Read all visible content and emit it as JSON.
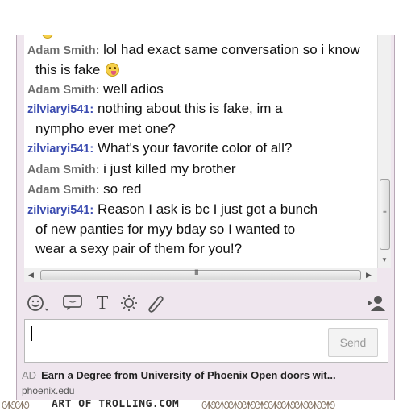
{
  "chat": {
    "messages": [
      {
        "sender": "Adam Smith:",
        "text": "lol had exact same conversation so i know",
        "cont": "this is fake"
      },
      {
        "sender": "Adam Smith:",
        "text": "well adios"
      },
      {
        "sender": "zilviaryi541:",
        "text": "nothing about this is fake, im a",
        "cont": "nympho ever met one?"
      },
      {
        "sender": "zilviaryi541:",
        "text": "What's your favorite color of all?"
      },
      {
        "sender": "Adam Smith:",
        "text": "i just killed my brother"
      },
      {
        "sender": "Adam Smith:",
        "text": "so red"
      },
      {
        "sender": "zilviaryi541:",
        "text": "Reason  I ask is bc I just got a bunch",
        "cont": "of new panties for myy bday so I wanted to",
        "cont2": "wear a sexy pair of them for you!?"
      }
    ]
  },
  "scroll": {
    "h_grip": "III",
    "v_grip": "≡",
    "left_arrow": "◀",
    "right_arrow": "▶",
    "down_arrow": "▼"
  },
  "toolbar": {
    "icons": [
      "smiley-icon",
      "wink-icon",
      "text-format-icon",
      "nudge-icon",
      "attach-icon",
      "contacts-icon"
    ],
    "text_glyph": "T"
  },
  "input": {
    "value": "",
    "send_label": "Send"
  },
  "ad": {
    "label": "AD",
    "text": "Earn a Degree from University of Phoenix Open doors wit...",
    "url": "phoenix.edu"
  },
  "watermark": {
    "text": "ART OF TROLLING.COM"
  }
}
